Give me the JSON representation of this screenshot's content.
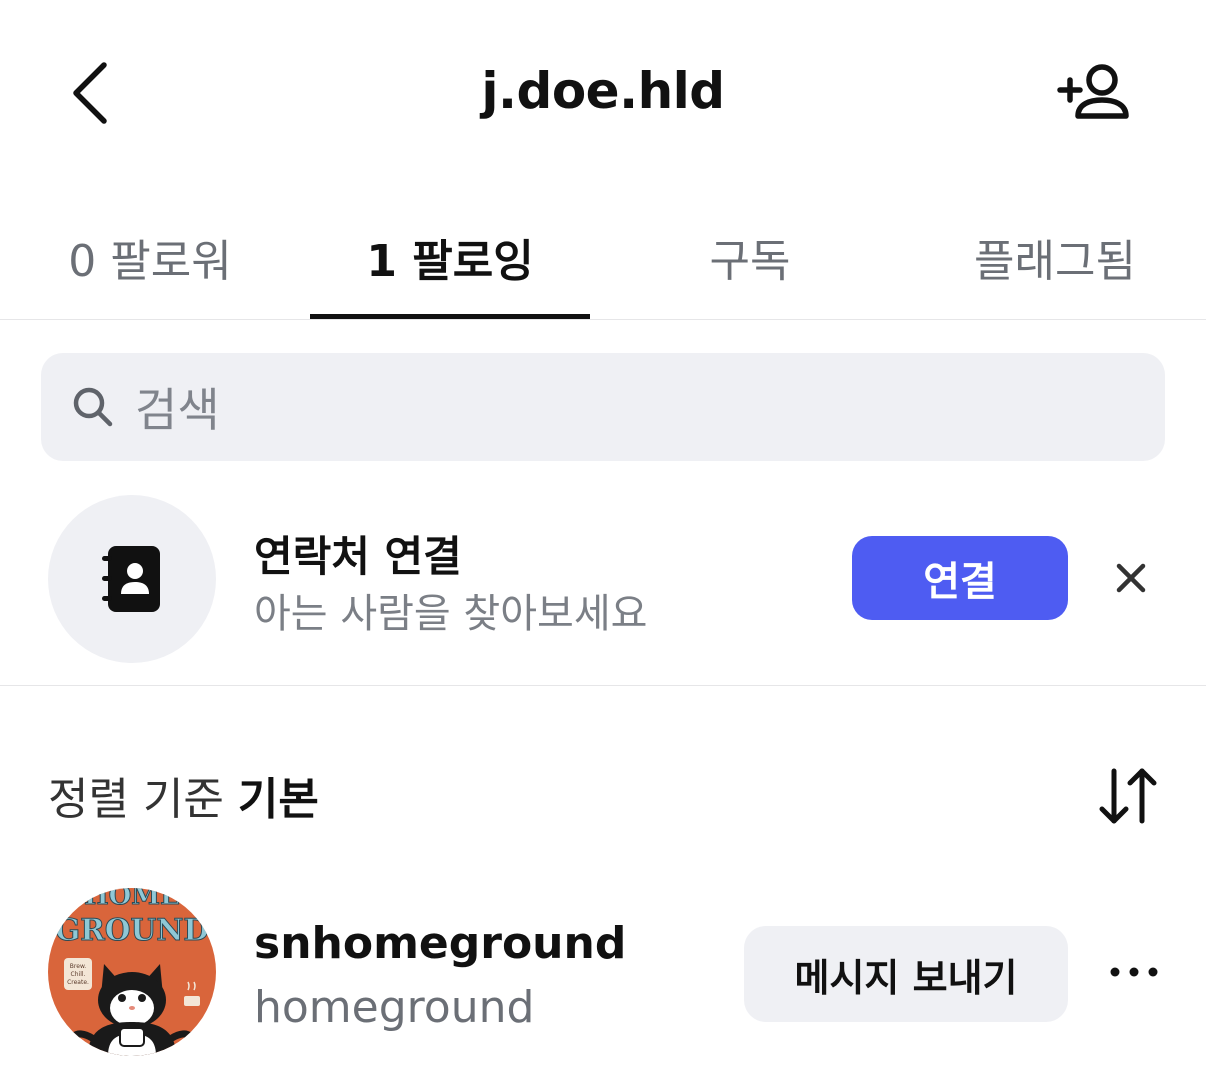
{
  "header": {
    "title": "j.doe.hld",
    "back_icon": "chevron-left-icon",
    "add_user_icon": "add-person-icon"
  },
  "tabs": [
    {
      "label": "0 팔로워",
      "active": false
    },
    {
      "label": "1 팔로잉",
      "active": true
    },
    {
      "label": "구독",
      "active": false
    },
    {
      "label": "플래그됨",
      "active": false
    }
  ],
  "search": {
    "placeholder": "검색",
    "icon": "search-icon"
  },
  "contacts_card": {
    "title": "연락처 연결",
    "subtitle": "아는 사람을 찾아보세요",
    "button_label": "연결",
    "icon": "contact-book-icon",
    "dismiss_icon": "close-icon"
  },
  "sort": {
    "label": "정렬 기준",
    "value": "기본",
    "icon": "sort-arrows-icon"
  },
  "following": [
    {
      "username": "snhomeground",
      "display_name": "homeground",
      "avatar_text_top": "HOME",
      "avatar_text_main": "GROUND",
      "avatar_badge": [
        "Brew.",
        "Chill.",
        "Create."
      ],
      "message_button": "메시지 보내기",
      "more_icon": "more-horizontal-icon"
    }
  ],
  "colors": {
    "accent": "#4e5cf2",
    "muted_bg": "#eff0f4",
    "muted_text": "#6b6f76",
    "avatar_bg": "#d9653b",
    "avatar_text": "#8fc8d6"
  }
}
